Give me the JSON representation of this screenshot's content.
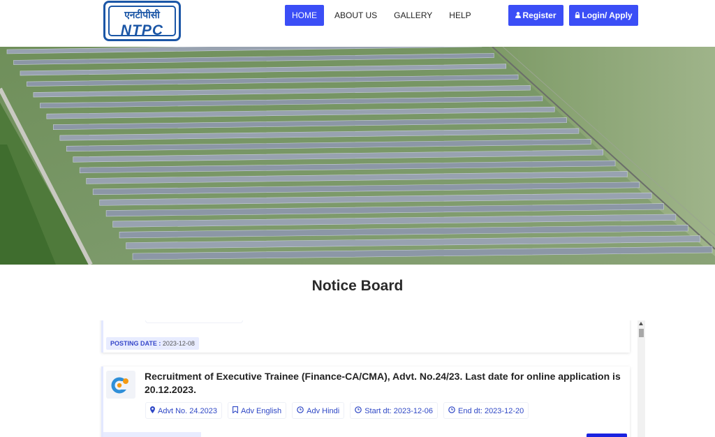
{
  "logo": {
    "hindi": "एनटीपीसी",
    "english": "NTPC"
  },
  "nav": {
    "items": [
      {
        "label": "HOME",
        "active": true
      },
      {
        "label": "ABOUT US",
        "active": false
      },
      {
        "label": "GALLERY",
        "active": false
      },
      {
        "label": "HELP",
        "active": false
      }
    ]
  },
  "auth": {
    "register_label": "Register",
    "login_label": "Login/ Apply",
    "register_icon": "user-icon",
    "login_icon": "lock-icon"
  },
  "notice_board": {
    "title": "Notice Board",
    "previous_posting": {
      "label": "POSTING DATE :",
      "value": "2023-12-08"
    },
    "notice": {
      "icon": "ntpc-emblem-icon",
      "title": "Recruitment of Executive Trainee (Finance-CA/CMA), Advt. No.24/23. Last date for online application is 20.12.2023.",
      "chips": [
        {
          "icon": "map-marker-icon",
          "text": "Advt No. 24.2023"
        },
        {
          "icon": "bookmark-icon",
          "text": "Adv English"
        },
        {
          "icon": "clock-icon",
          "text": "Adv Hindi"
        },
        {
          "icon": "clock-icon",
          "text": "Start dt: 2023-12-06"
        },
        {
          "icon": "clock-icon",
          "text": "End dt: 2023-12-20"
        }
      ]
    }
  },
  "colors": {
    "accent": "#3b4ef6",
    "brand": "#1b56a6",
    "chip_text": "#2f48c6",
    "chip_bg": "#e8ecff"
  }
}
